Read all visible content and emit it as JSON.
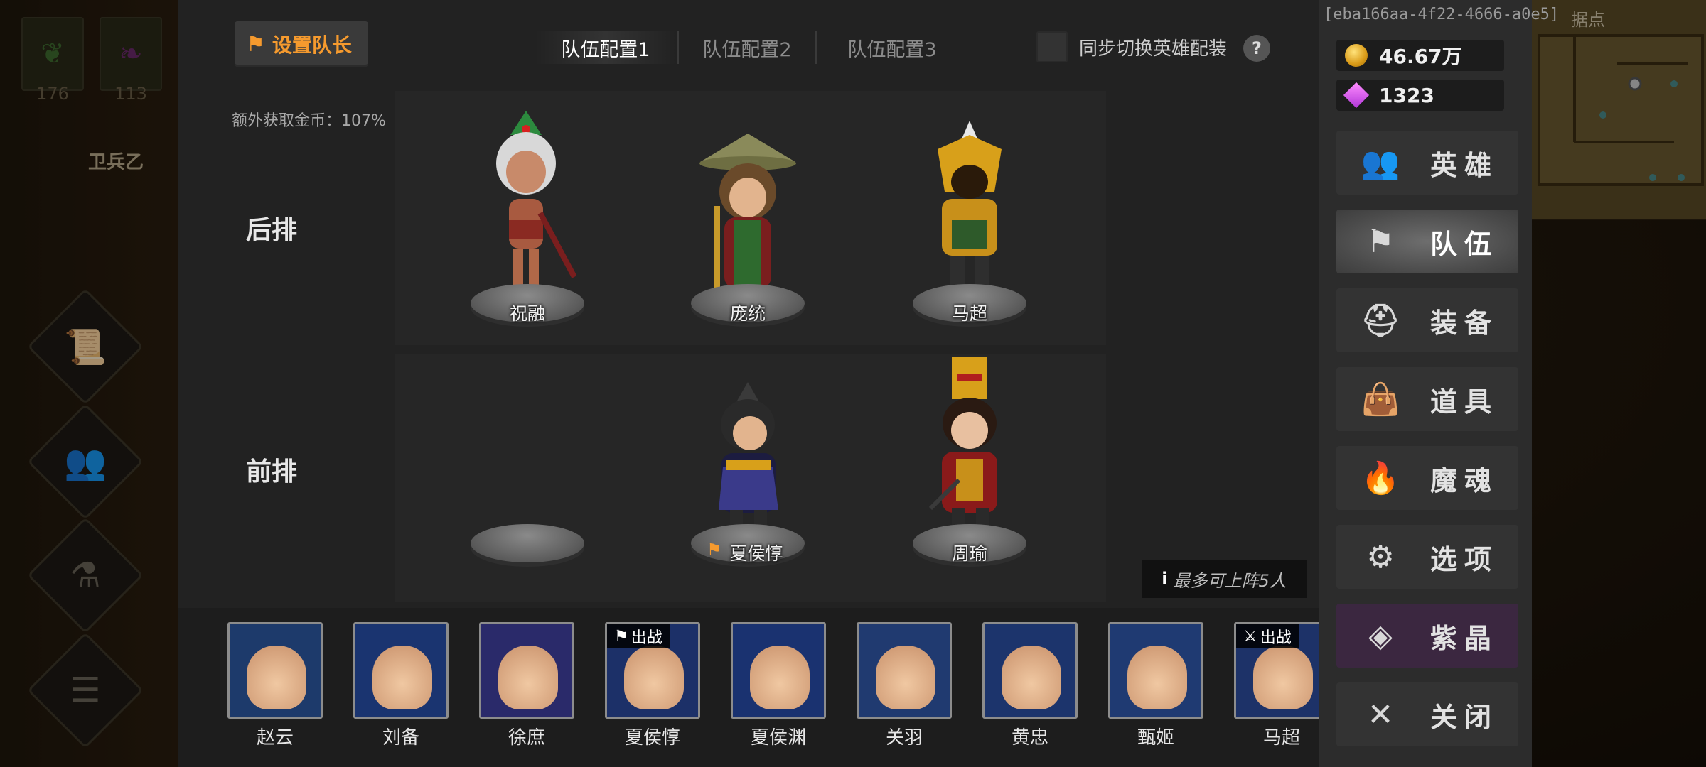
{
  "background": {
    "slots": [
      {
        "count": "176",
        "icon": "leaf-item-icon"
      },
      {
        "count": "113",
        "icon": "feather-item-icon"
      }
    ],
    "guard_name": "卫兵乙",
    "side_buttons": [
      "scroll-icon",
      "people-icon",
      "potion-icon",
      "list-icon"
    ],
    "map_label": "据点"
  },
  "header": {
    "set_captain_label": "设置队长",
    "tabs": [
      {
        "label": "队伍配置1",
        "active": true
      },
      {
        "label": "队伍配置2",
        "active": false
      },
      {
        "label": "队伍配置3",
        "active": false
      }
    ],
    "sync_label": "同步切换英雄配装",
    "help_glyph": "?"
  },
  "extra_gold_label": "额外获取金币：107%",
  "rows": {
    "back": {
      "label": "后排",
      "slots": [
        {
          "name": "祝融"
        },
        {
          "name": "庞统"
        },
        {
          "name": "马超"
        }
      ]
    },
    "front": {
      "label": "前排",
      "slots": [
        {
          "name": ""
        },
        {
          "name": "夏侯惇",
          "captain": true
        },
        {
          "name": "周瑜"
        }
      ]
    }
  },
  "max_note": "最多可上阵5人",
  "bench": [
    {
      "name": "赵云",
      "color": "#1d3a6b"
    },
    {
      "name": "刘备",
      "color": "#1a3470"
    },
    {
      "name": "徐庶",
      "color": "#2a2a6a"
    },
    {
      "name": "夏侯惇",
      "color": "#1c3068",
      "badge": "出战",
      "badge_icon": "flag-icon"
    },
    {
      "name": "夏侯渊",
      "color": "#1a3270"
    },
    {
      "name": "关羽",
      "color": "#203a70"
    },
    {
      "name": "黄忠",
      "color": "#1c346c"
    },
    {
      "name": "甄姬",
      "color": "#1f3a72"
    },
    {
      "name": "马超",
      "color": "#1d3268",
      "badge": "出战",
      "badge_icon": "crossed-swords-icon"
    }
  ],
  "side": {
    "uid": "[eba166aa-4f22-4666-a0e5]",
    "gold": "46.67万",
    "gems": "1323",
    "menu": [
      {
        "label": "英雄",
        "icon": "heroes-icon",
        "glyph": "👥",
        "active": false
      },
      {
        "label": "队伍",
        "icon": "flag-icon",
        "glyph": "⚑",
        "active": true
      },
      {
        "label": "装备",
        "icon": "helmet-icon",
        "glyph": "⛑",
        "active": false
      },
      {
        "label": "道具",
        "icon": "bag-icon",
        "glyph": "👜",
        "active": false
      },
      {
        "label": "魔魂",
        "icon": "flame-icon",
        "glyph": "🔥",
        "active": false
      },
      {
        "label": "选项",
        "icon": "gear-icon",
        "glyph": "⚙",
        "active": false
      },
      {
        "label": "紫晶",
        "icon": "crystal-icon",
        "glyph": "◈",
        "active": false,
        "purple": true
      },
      {
        "label": "关闭",
        "icon": "close-icon",
        "glyph": "✕",
        "active": false
      }
    ]
  }
}
